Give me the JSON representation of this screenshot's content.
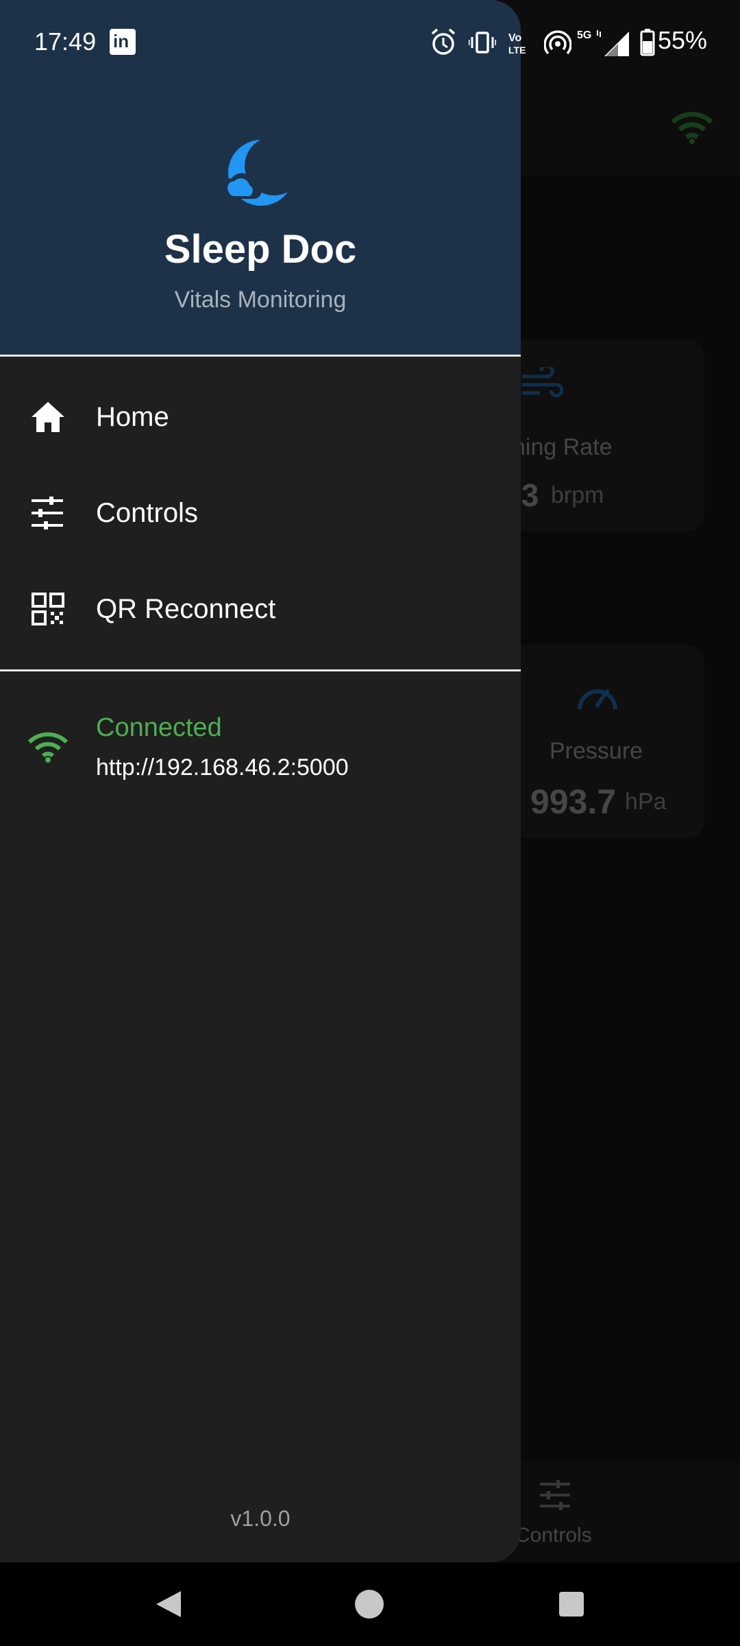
{
  "status_bar": {
    "time": "17:49",
    "linkedin_glyph": "in",
    "battery": "55%",
    "icons": [
      "linkedin-icon",
      "alarm-icon",
      "vibrate-icon",
      "volte-icon",
      "hotspot-icon",
      "5g-signal-icon",
      "battery-icon"
    ]
  },
  "drawer": {
    "app_title": "Sleep Doc",
    "app_subtitle": "Vitals Monitoring",
    "menu": [
      {
        "label": "Home",
        "icon": "home-icon"
      },
      {
        "label": "Controls",
        "icon": "tune-icon"
      },
      {
        "label": "QR Reconnect",
        "icon": "qr-code-icon"
      }
    ],
    "connection": {
      "status": "Connected",
      "url": "http://192.168.46.2:5000",
      "icon": "wifi-icon"
    },
    "version": "v1.0.0"
  },
  "background": {
    "breathing_card": {
      "label_fragment": "hing Rate",
      "value_fragment": ".3",
      "unit": "brpm"
    },
    "pressure_card": {
      "label": "Pressure",
      "value": "993.7",
      "unit": "hPa"
    },
    "bottom_nav": {
      "controls_label": "Controls"
    }
  },
  "colors": {
    "accent": "#2196f3",
    "connected": "#4caf50",
    "drawer_header": "#1d3249",
    "drawer_bg": "#1f1f1f"
  }
}
